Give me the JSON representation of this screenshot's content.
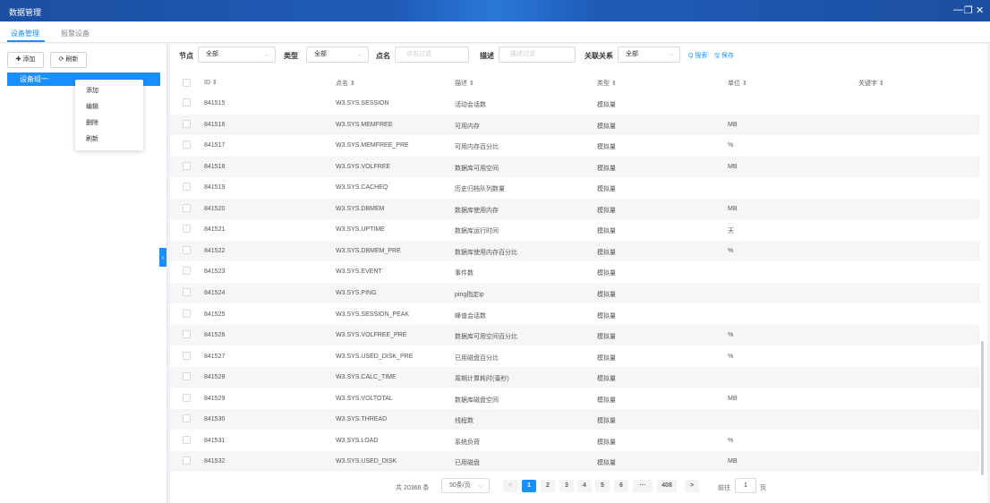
{
  "window": {
    "title": "数据管理",
    "minimize": "—",
    "restore": "❐",
    "close": "✕"
  },
  "tabs": [
    {
      "label": "设备管理",
      "active": true
    },
    {
      "label": "报警设备"
    }
  ],
  "left": {
    "add_label": "✚ 添加",
    "refresh_label": "⟳ 刷新",
    "tree_node": "设备组一",
    "context_menu": [
      "添加",
      "编辑",
      "删除",
      "刷新"
    ],
    "collapse_glyph": "‹"
  },
  "filters": {
    "node_label": "节点",
    "node_value": "全部",
    "type_label": "类型",
    "type_value": "全部",
    "name_label": "点名",
    "name_placeholder": "点名过滤",
    "desc_label": "描述",
    "desc_placeholder": "描述过滤",
    "rel_label": "关联关系",
    "rel_value": "全部",
    "search": "Q 搜索",
    "save": "🖫 保存"
  },
  "table": {
    "columns": [
      "ID ⇕",
      "点名 ⇕",
      "描述 ⇕",
      "类型 ⇕",
      "单位 ⇕",
      "关键字 ⇕"
    ],
    "rows": [
      {
        "id": "841515",
        "name": "W3.SYS.SESSION",
        "desc": "活动会话数",
        "type": "模拟量",
        "unit": ""
      },
      {
        "id": "841516",
        "name": "W3.SYS.MEMFREE",
        "desc": "可用内存",
        "type": "模拟量",
        "unit": "MB"
      },
      {
        "id": "841517",
        "name": "W3.SYS.MEMFREE_PRE",
        "desc": "可用内存百分比",
        "type": "模拟量",
        "unit": "%"
      },
      {
        "id": "841518",
        "name": "W3.SYS.VOLFREE",
        "desc": "数据库可用空间",
        "type": "模拟量",
        "unit": "MB"
      },
      {
        "id": "841519",
        "name": "W3.SYS.CACHEQ",
        "desc": "历史归档队列数量",
        "type": "模拟量",
        "unit": ""
      },
      {
        "id": "841520",
        "name": "W3.SYS.DBMEM",
        "desc": "数据库使用内存",
        "type": "模拟量",
        "unit": "MB"
      },
      {
        "id": "841521",
        "name": "W3.SYS.UPTIME",
        "desc": "数据库运行时间",
        "type": "模拟量",
        "unit": "天"
      },
      {
        "id": "841522",
        "name": "W3.SYS.DBMEM_PRE",
        "desc": "数据库使用内存百分比",
        "type": "模拟量",
        "unit": "%"
      },
      {
        "id": "841523",
        "name": "W3.SYS.EVENT",
        "desc": "事件数",
        "type": "模拟量",
        "unit": ""
      },
      {
        "id": "841524",
        "name": "W3.SYS.PING",
        "desc": "ping指定ip",
        "type": "模拟量",
        "unit": ""
      },
      {
        "id": "841525",
        "name": "W3.SYS.SESSION_PEAK",
        "desc": "峰值会话数",
        "type": "模拟量",
        "unit": ""
      },
      {
        "id": "841526",
        "name": "W3.SYS.VOLFREE_PRE",
        "desc": "数据库可用空间百分比",
        "type": "模拟量",
        "unit": "%"
      },
      {
        "id": "841527",
        "name": "W3.SYS.USED_DISK_PRE",
        "desc": "已用磁盘百分比",
        "type": "模拟量",
        "unit": "%"
      },
      {
        "id": "841528",
        "name": "W3.SYS.CALC_TIME",
        "desc": "周期计算耗时(毫秒)",
        "type": "模拟量",
        "unit": ""
      },
      {
        "id": "841529",
        "name": "W3.SYS.VOLTOTAL",
        "desc": "数据库磁盘空间",
        "type": "模拟量",
        "unit": "MB"
      },
      {
        "id": "841530",
        "name": "W3.SYS.THREAD",
        "desc": "线程数",
        "type": "模拟量",
        "unit": ""
      },
      {
        "id": "841531",
        "name": "W3.SYS.LOAD",
        "desc": "系统负荷",
        "type": "模拟量",
        "unit": "%"
      },
      {
        "id": "841532",
        "name": "W3.SYS.USED_DISK",
        "desc": "已用磁盘",
        "type": "模拟量",
        "unit": "MB"
      }
    ]
  },
  "pagination": {
    "total": "共 20366 条",
    "page_size": "50条/页",
    "prev": "<",
    "next": ">",
    "pages": [
      "1",
      "2",
      "3",
      "4",
      "5",
      "6",
      "···",
      "408"
    ],
    "current": "1",
    "goto_label": "前往",
    "goto_value": "1",
    "page_suffix": "页"
  },
  "colors": {
    "accent": "#1890ff",
    "titlebar": "#1f5cb8"
  }
}
